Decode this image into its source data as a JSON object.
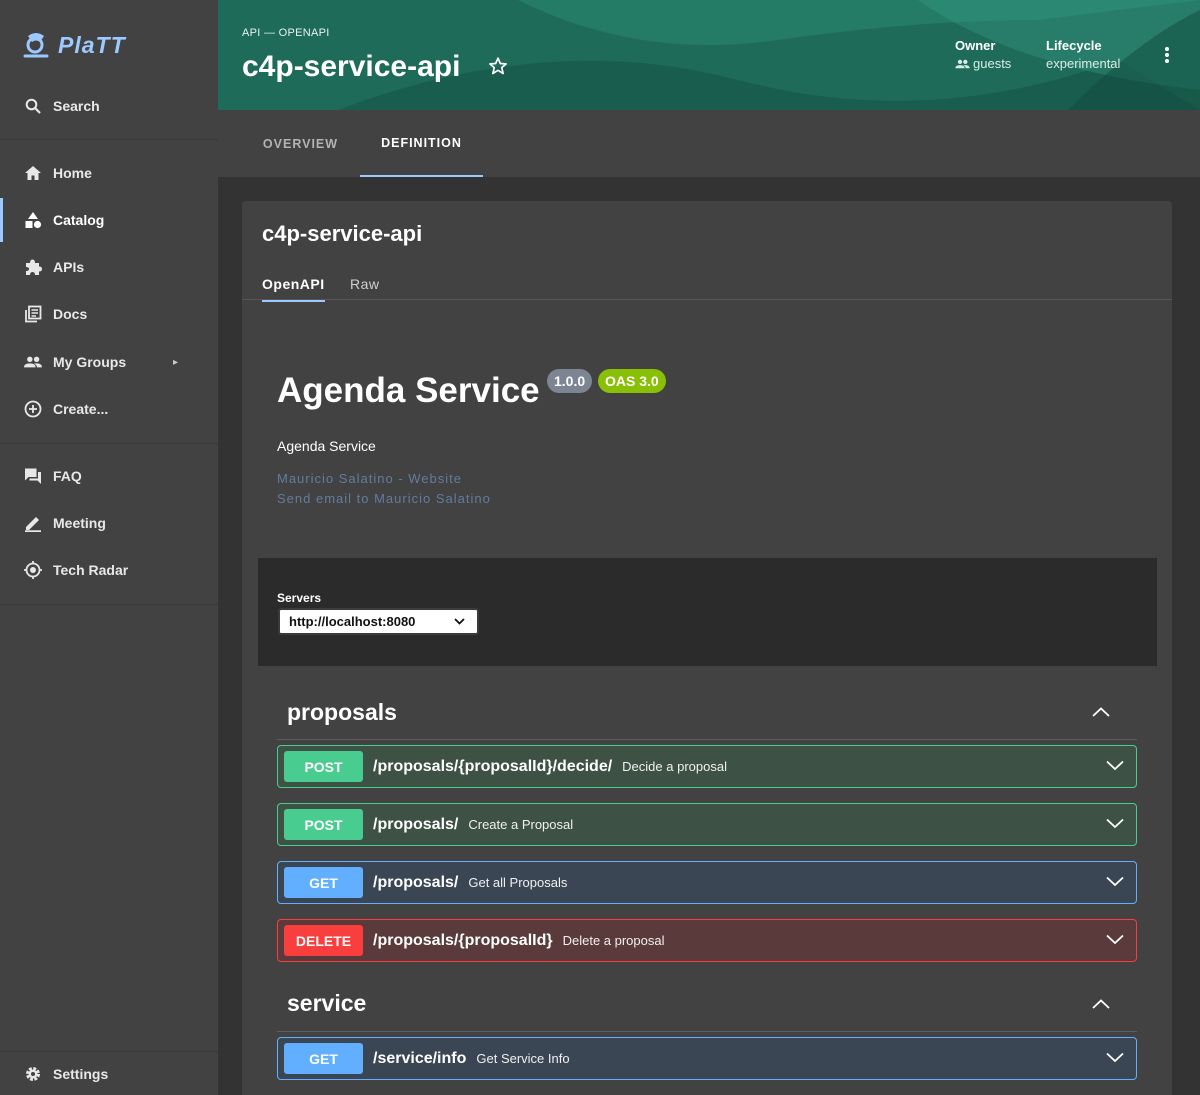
{
  "brand": {
    "name": "PlaTT"
  },
  "sidebar": {
    "search_label": "Search",
    "items": [
      {
        "label": "Home",
        "icon": "home-icon"
      },
      {
        "label": "Catalog",
        "icon": "catalog-icon"
      },
      {
        "label": "APIs",
        "icon": "puzzle-icon"
      },
      {
        "label": "Docs",
        "icon": "docs-icon"
      },
      {
        "label": "My Groups",
        "icon": "groups-icon"
      },
      {
        "label": "Create...",
        "icon": "add-circle-icon"
      },
      {
        "label": "FAQ",
        "icon": "forum-icon"
      },
      {
        "label": "Meeting",
        "icon": "pencil-icon"
      },
      {
        "label": "Tech Radar",
        "icon": "radar-icon"
      }
    ],
    "settings_label": "Settings"
  },
  "header": {
    "breadcrumb": "API — OPENAPI",
    "title": "c4p-service-api",
    "owner_label": "Owner",
    "owner_value": "guests",
    "lifecycle_label": "Lifecycle",
    "lifecycle_value": "experimental"
  },
  "tabs": [
    {
      "label": "OVERVIEW"
    },
    {
      "label": "DEFINITION"
    }
  ],
  "definition": {
    "card_title": "c4p-service-api",
    "subtabs": [
      {
        "label": "OpenAPI"
      },
      {
        "label": "Raw"
      }
    ],
    "api": {
      "title": "Agenda Service",
      "version": "1.0.0",
      "oas": "OAS 3.0",
      "description": "Agenda Service",
      "link1": "Mauricio Salatino - Website",
      "link2": "Send email to Mauricio Salatino"
    },
    "servers": {
      "label": "Servers",
      "selected": "http://localhost:8080"
    },
    "sections": [
      {
        "name": "proposals",
        "operations": [
          {
            "method": "POST",
            "path": "/proposals/{proposalId}/decide/",
            "summary": "Decide a proposal"
          },
          {
            "method": "POST",
            "path": "/proposals/",
            "summary": "Create a Proposal"
          },
          {
            "method": "GET",
            "path": "/proposals/",
            "summary": "Get all Proposals"
          },
          {
            "method": "DELETE",
            "path": "/proposals/{proposalId}",
            "summary": "Delete a proposal"
          }
        ]
      },
      {
        "name": "service",
        "operations": [
          {
            "method": "GET",
            "path": "/service/info",
            "summary": "Get Service Info"
          }
        ]
      }
    ]
  },
  "colors": {
    "accent": "#9cc9ff",
    "header_green": "#1f6e5c",
    "post": "#49cc90",
    "get": "#61affe",
    "delete": "#f93e3e",
    "version_badge": "#7d8492",
    "oas_badge": "#89bf04"
  }
}
